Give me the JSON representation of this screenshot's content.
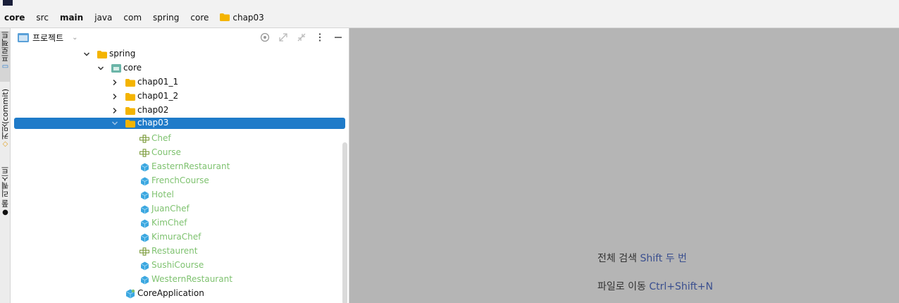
{
  "breadcrumb": {
    "items": [
      {
        "label": "core",
        "bold": true
      },
      {
        "label": "src",
        "bold": false
      },
      {
        "label": "main",
        "bold": true
      },
      {
        "label": "java",
        "bold": false
      },
      {
        "label": "com",
        "bold": false
      },
      {
        "label": "spring",
        "bold": false
      },
      {
        "label": "core",
        "bold": false
      },
      {
        "label": "chap03",
        "bold": false,
        "icon": "folder-icon"
      }
    ]
  },
  "sidebar_strip": {
    "project_tab": "프로젝트",
    "commit_tab": "커밋(commit)",
    "pull_requests_tab": "풀 리퀘스트"
  },
  "project_panel": {
    "title": "프로젝트",
    "tree": [
      {
        "label": "spring",
        "type": "folder",
        "depth": 0,
        "expanded": true
      },
      {
        "label": "core",
        "type": "package",
        "depth": 1,
        "expanded": true
      },
      {
        "label": "chap01_1",
        "type": "folder",
        "depth": 2,
        "expanded": false
      },
      {
        "label": "chap01_2",
        "type": "folder",
        "depth": 2,
        "expanded": false
      },
      {
        "label": "chap02",
        "type": "folder",
        "depth": 2,
        "expanded": false
      },
      {
        "label": "chap03",
        "type": "folder",
        "depth": 2,
        "expanded": true,
        "selected": true
      },
      {
        "label": "Chef",
        "type": "interface",
        "depth": 3
      },
      {
        "label": "Course",
        "type": "interface",
        "depth": 3
      },
      {
        "label": "EasternRestaurant",
        "type": "class",
        "depth": 3
      },
      {
        "label": "FrenchCourse",
        "type": "class",
        "depth": 3
      },
      {
        "label": "Hotel",
        "type": "class",
        "depth": 3
      },
      {
        "label": "JuanChef",
        "type": "class",
        "depth": 3
      },
      {
        "label": "KimChef",
        "type": "class",
        "depth": 3
      },
      {
        "label": "KimuraChef",
        "type": "class",
        "depth": 3
      },
      {
        "label": "Restaurent",
        "type": "interface",
        "depth": 3
      },
      {
        "label": "SushiCourse",
        "type": "class",
        "depth": 3
      },
      {
        "label": "WesternRestaurant",
        "type": "class",
        "depth": 3
      },
      {
        "label": "CoreApplication",
        "type": "app-class",
        "depth": 2
      }
    ]
  },
  "editor": {
    "hint_search_label": "전체 검색",
    "hint_search_key": "Shift 두 번",
    "hint_goto_label": "파일로 이동",
    "hint_goto_key": "Ctrl+Shift+N"
  },
  "colors": {
    "selection": "#1f7bc9",
    "folder": "#f4b400",
    "class_icon": "#3ba7e0",
    "new_file_text": "#7ec26f",
    "editor_bg": "#b5b5b5",
    "shortcut_key": "#3a4f8f"
  }
}
